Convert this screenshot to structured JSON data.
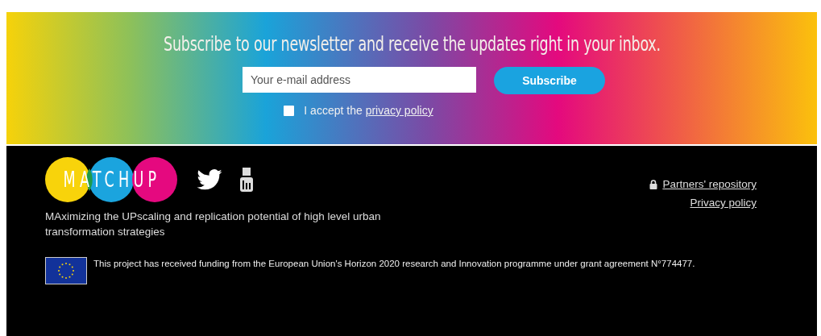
{
  "newsletter": {
    "heading": "Subscribe to our newsletter and receive the updates right in your inbox.",
    "email_field": {
      "placeholder": "Your e-mail address"
    },
    "button": "Subscribe",
    "consent": {
      "checked": false,
      "text": "I accept the",
      "link": "privacy policy"
    }
  },
  "footer": {
    "logo": "MATCHUP",
    "tagline": "MAximizing the UPscaling and replication potential of high level urban transformation strategies",
    "links": [
      {
        "label": "Partners' repository",
        "locked": true
      },
      {
        "label": "Privacy policy",
        "locked": false
      }
    ],
    "funding": "This project has received funding from the European Union's Horizon 2020 research and Innovation programme under grant agreement N°774477."
  }
}
